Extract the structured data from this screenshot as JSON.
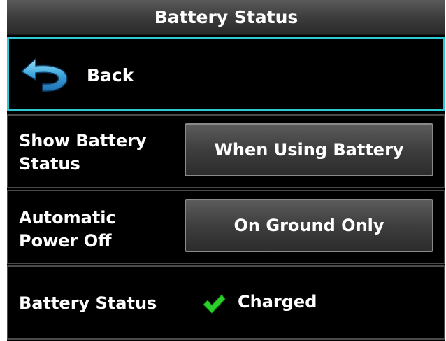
{
  "header": {
    "title": "Battery Status"
  },
  "back": {
    "label": "Back",
    "icon": "back-arrow-icon",
    "highlight_color": "#2ec8d4"
  },
  "settings": [
    {
      "label": "Show Battery Status",
      "value": "When Using Battery"
    },
    {
      "label": "Automatic Power Off",
      "value": "On Ground Only"
    }
  ],
  "status": {
    "label": "Battery Status",
    "value": "Charged",
    "icon": "checkmark-icon",
    "icon_color": "#2bd12b"
  }
}
